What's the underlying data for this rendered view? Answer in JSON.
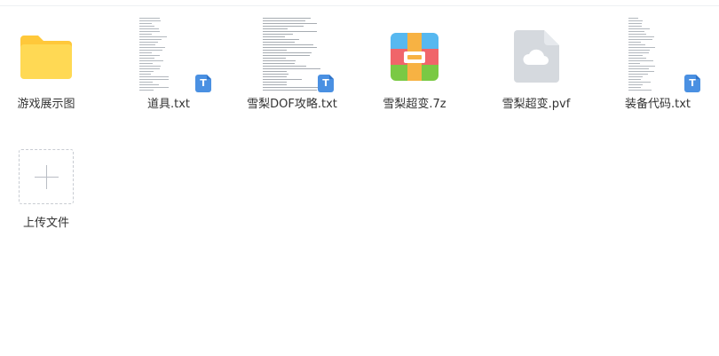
{
  "files": [
    {
      "label": "游戏展示图",
      "icon": "folder-icon"
    },
    {
      "label": "道具.txt",
      "icon": "txt-file-icon"
    },
    {
      "label": "雪梨DOF攻略.txt",
      "icon": "txt-file-icon"
    },
    {
      "label": "雪梨超变.7z",
      "icon": "archive-icon"
    },
    {
      "label": "雪梨超变.pvf",
      "icon": "cloud-file-icon"
    },
    {
      "label": "装备代码.txt",
      "icon": "txt-file-icon"
    }
  ],
  "upload": {
    "label": "上传文件",
    "icon": "plus-icon"
  },
  "badge_letter": "T",
  "colors": {
    "folder": "#ffd54a",
    "txt_badge": "#4a90e2",
    "archive_red": "#f0656a",
    "archive_blue": "#57b8f0",
    "archive_green": "#7ac944",
    "archive_zip": "#f7b243",
    "cloud_file": "#d7dbe0"
  }
}
